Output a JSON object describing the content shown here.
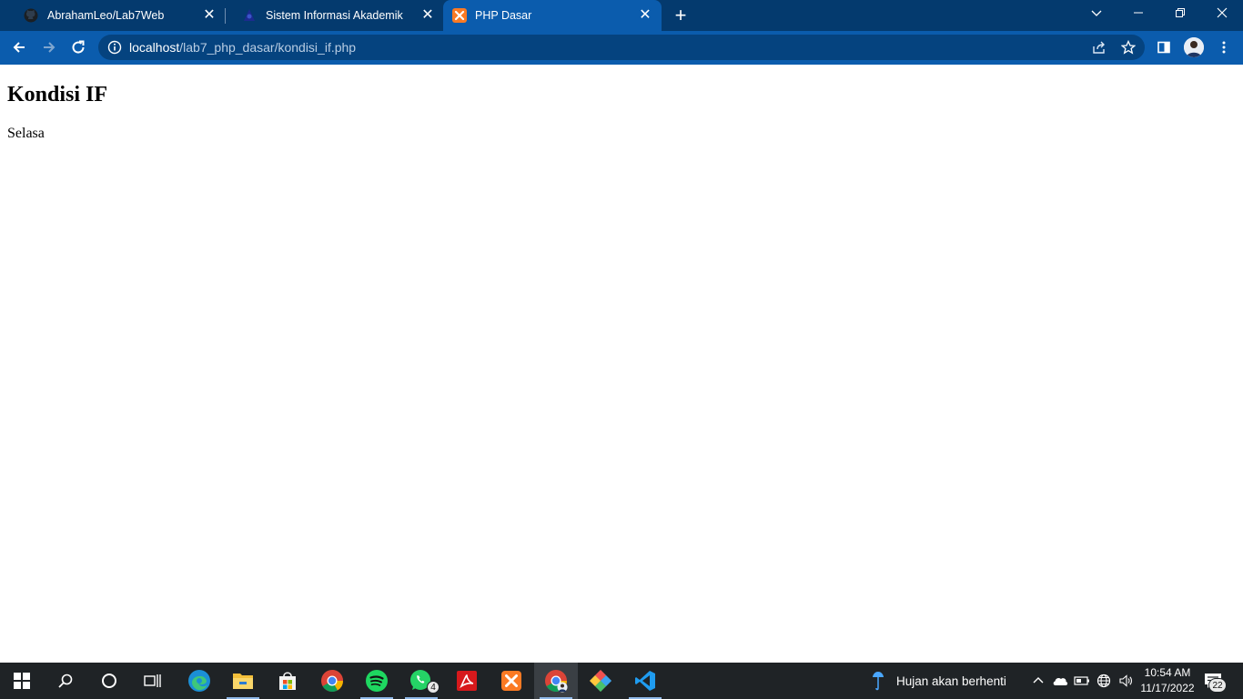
{
  "browser": {
    "tabs": [
      {
        "title": "AbrahamLeo/Lab7Web",
        "favicon": "github-icon",
        "active": false
      },
      {
        "title": "Sistem Informasi Akademik",
        "favicon": "site-logo-icon",
        "active": false
      },
      {
        "title": "PHP Dasar",
        "favicon": "xampp-icon",
        "active": true
      }
    ],
    "address": {
      "host": "localhost",
      "path": "/lab7_php_dasar/kondisi_if.php"
    },
    "colors": {
      "tabstrip": "#043a6e",
      "toolbar": "#0b5cad",
      "omnibox": "#05437f"
    }
  },
  "page": {
    "heading": "Kondisi IF",
    "text": "Selasa"
  },
  "taskbar": {
    "apps": [
      "start-icon",
      "search-icon",
      "cortana-icon",
      "task-view-icon",
      "edge-icon",
      "file-explorer-icon",
      "store-icon",
      "chrome-icon",
      "spotify-icon",
      "whatsapp-icon",
      "acrobat-icon",
      "xampp-icon",
      "chrome-profile-icon",
      "git-icon",
      "vscode-icon"
    ],
    "whatsapp_badge": "4",
    "weather": "Hujan akan berhenti",
    "time": "10:54 AM",
    "date": "11/17/2022",
    "notifications": "22"
  }
}
